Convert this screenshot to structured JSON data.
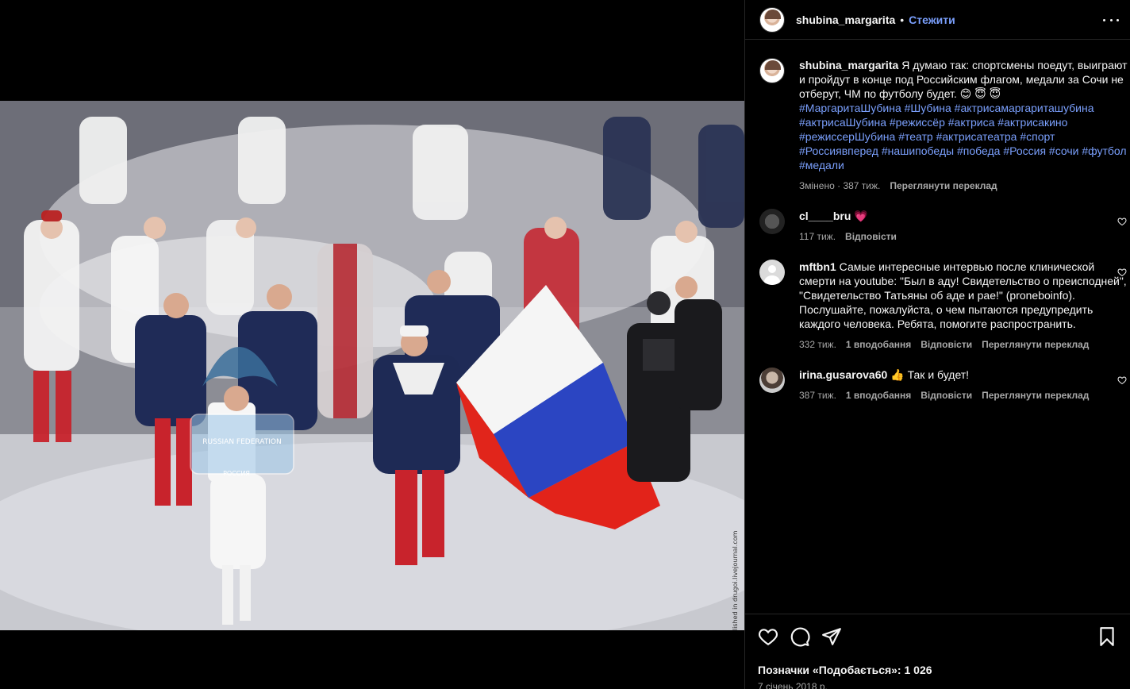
{
  "post": {
    "username": "shubina_margarita",
    "follow_label": "Стежити",
    "separator": "•",
    "photo_credit": "© РИА НОВОСТИ | published in drugoi.livejournal.com",
    "photo_texts": [
      "RUSSIAN FEDERATION",
      "РОССИЯ"
    ]
  },
  "caption": {
    "username": "shubina_margarita",
    "text": "Я думаю так: спортсмены поедут, выиграют и пройдут в конце под Российским флагом, медали за Сочи не отберут, ЧМ по футболу будет. 😊 😇 😇",
    "hashtags": "#МаргаритаШубина #Шубина #актрисамаргариташубина #актрисаШубина #режиссёр #актриса #актрисакино #режиссерШубина #театр #актрисатеатра #спорт #Россиявперед #нашипобеды #победа #Россия #сочи #футбол #медали",
    "edited": "Змінено",
    "time": "387 тиж.",
    "translate": "Переглянути переклад"
  },
  "comments": [
    {
      "username": "cl____bru",
      "text": "💗",
      "time": "117 тиж.",
      "reply": "Відповісти"
    },
    {
      "username": "mftbn1",
      "text": "Самые интересные интервью после клинической смерти на youtube: \"Был в аду! Свидетельство о преисподней\", \"Свидетельство Татьяны об аде и рае!\" (proneboinfo). Послушайте, пожалуйста, о чем пытаются предупредить каждого человека. Ребята, помогите распространить.",
      "time": "332 тиж.",
      "likes": "1 вподобання",
      "reply": "Відповісти",
      "translate": "Переглянути переклад"
    },
    {
      "username": "irina.gusarova60",
      "text": "👍 Так и будет!",
      "time": "387 тиж.",
      "likes": "1 вподобання",
      "reply": "Відповісти",
      "translate": "Переглянути переклад"
    }
  ],
  "footer": {
    "likes_label": "Позначки «Подобається»: 1 026",
    "date": "7 січень 2018 р."
  },
  "icons": {
    "like": "heart-icon",
    "comment": "comment-icon",
    "share": "send-icon",
    "save": "bookmark-icon",
    "more": "more-icon"
  }
}
